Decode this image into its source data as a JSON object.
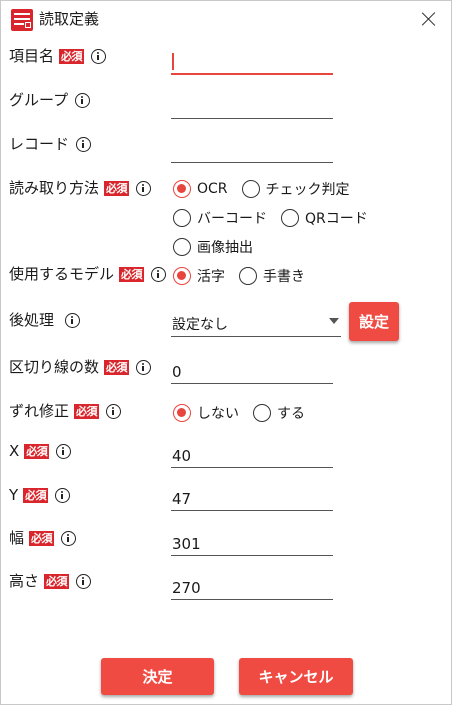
{
  "window": {
    "title": "読取定義",
    "app_icon": "app-logo-icon",
    "close_icon": "close-icon"
  },
  "required_badge": "必須",
  "fields": {
    "item_name": {
      "label": "項目名",
      "value": ""
    },
    "group": {
      "label": "グループ",
      "value": ""
    },
    "record": {
      "label": "レコード",
      "value": ""
    },
    "threshold": {
      "label": "区切り線の数",
      "value": "0"
    },
    "x": {
      "label": "X",
      "value": "40"
    },
    "y": {
      "label": "Y",
      "value": "47"
    },
    "width": {
      "label": "幅",
      "value": "301"
    },
    "height": {
      "label": "高さ",
      "value": "270"
    }
  },
  "read_method": {
    "label": "読み取り方法",
    "options": [
      "OCR",
      "チェック判定",
      "バーコード",
      "QRコード",
      "画像抽出"
    ],
    "selected": "OCR"
  },
  "model": {
    "label": "使用するモデル",
    "options": [
      "活字",
      "手書き"
    ],
    "selected": "活字"
  },
  "postprocess": {
    "label": "後処理",
    "selected_value": "設定なし",
    "settings_label": "設定"
  },
  "skew": {
    "label": "ずれ修正",
    "options": [
      "しない",
      "する"
    ],
    "selected": "しない"
  },
  "footer": {
    "ok_label": "決定",
    "cancel_label": "キャンセル"
  },
  "colors": {
    "accent": "#ef4b43",
    "required_bg": "#d9262c"
  }
}
